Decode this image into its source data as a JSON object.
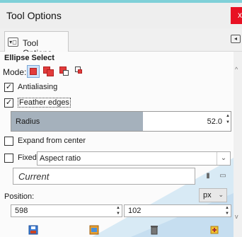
{
  "window": {
    "title": "Tool Options",
    "close_glyph": "x"
  },
  "tab": {
    "label": "Tool Options",
    "icon": "tool-options-icon",
    "menu_icon": "tab-menu-icon"
  },
  "tool": {
    "name": "Ellipse Select"
  },
  "mode": {
    "label": "Mode:",
    "options": [
      "replace-mode-icon",
      "add-mode-icon",
      "subtract-mode-icon",
      "intersect-mode-icon"
    ],
    "selected": "replace-mode-icon"
  },
  "antialiasing": {
    "label": "Antialiasing",
    "checked": true
  },
  "feather": {
    "label": "Feather edges",
    "checked": true
  },
  "radius": {
    "label": "Radius",
    "value": "52.0",
    "fraction": 0.6
  },
  "expand": {
    "label": "Expand from center",
    "checked": false
  },
  "fixed": {
    "label": "Fixed:",
    "checked": false,
    "value": "Aspect ratio"
  },
  "current": {
    "value": "Current"
  },
  "position": {
    "label": "Position:",
    "unit": "px",
    "x": "598",
    "y": "102"
  },
  "colors": {
    "accent": "#7fd0d8",
    "close": "#e81123",
    "radius_fill": "#a5b1bc"
  }
}
